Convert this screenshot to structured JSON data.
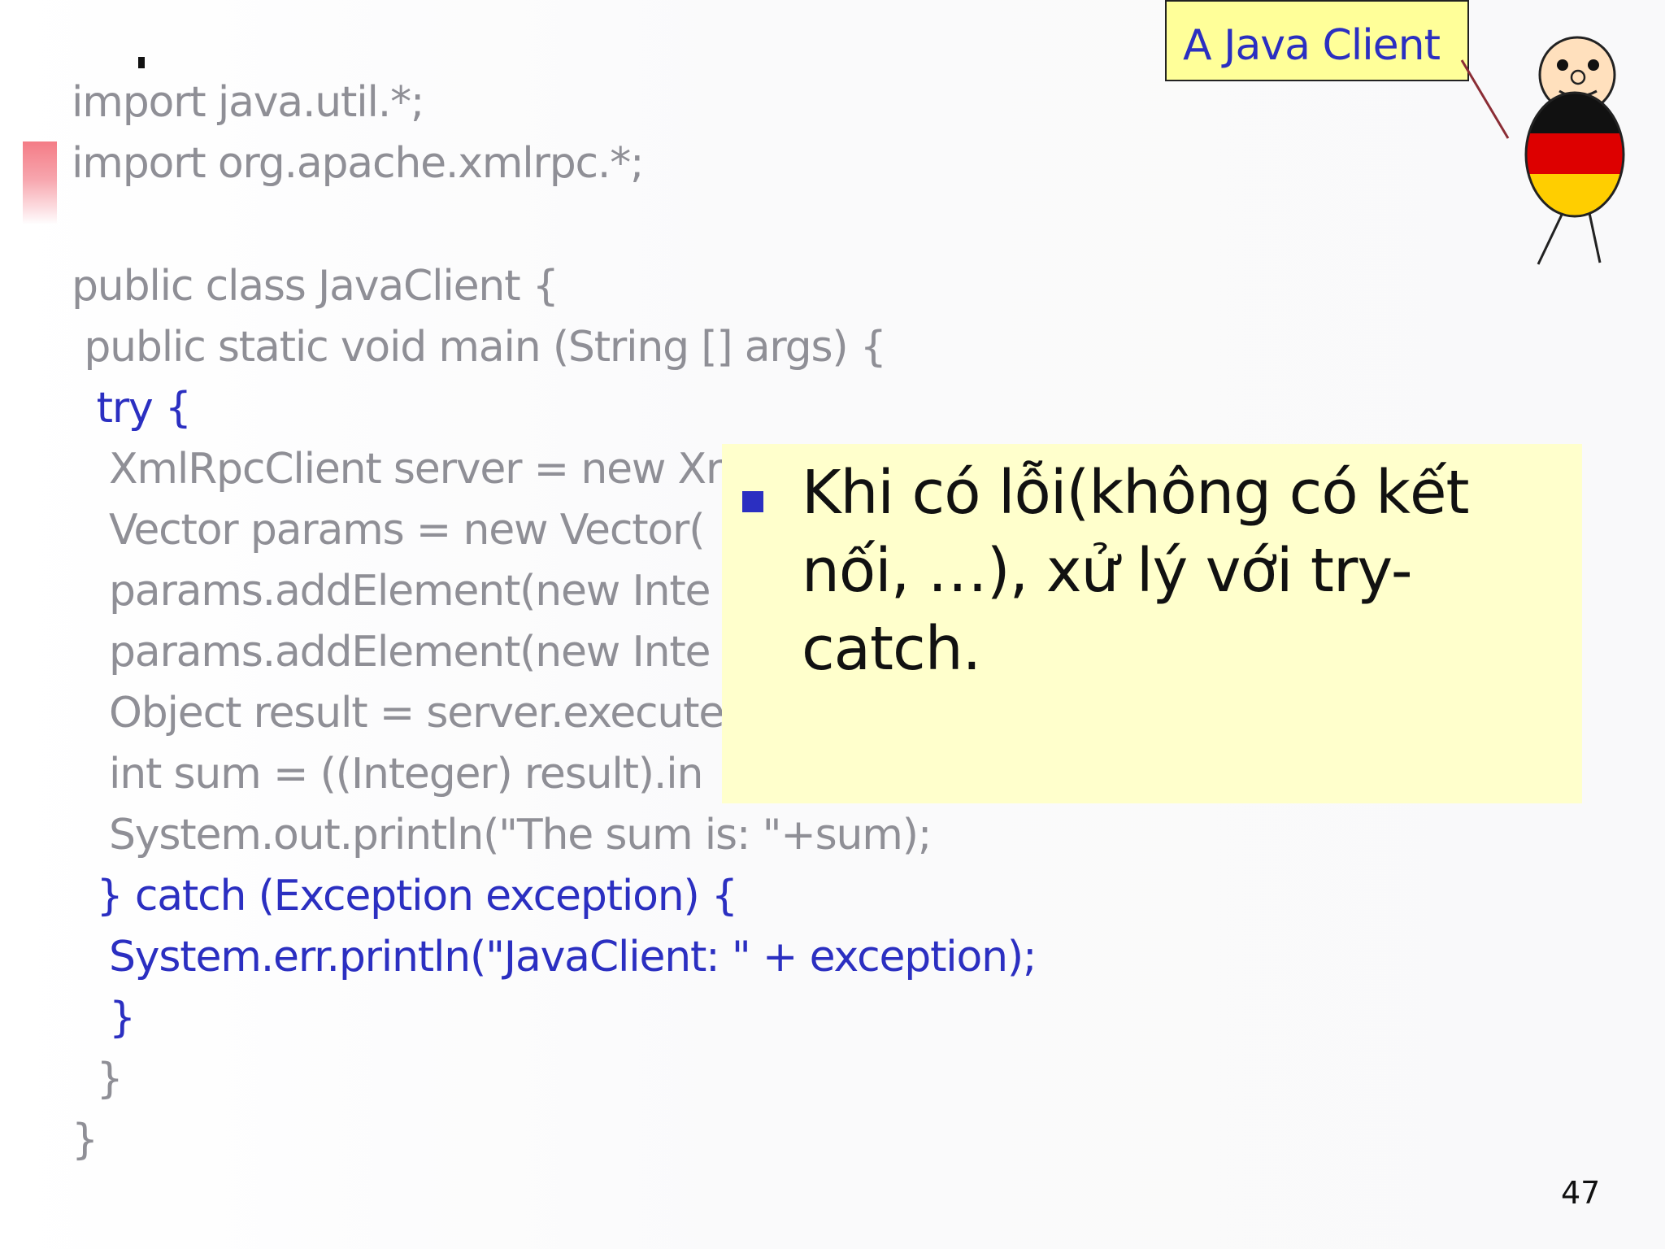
{
  "code": {
    "lines": [
      "import java.util.*;",
      "import org.apache.xmlrpc.*;",
      "public class JavaClient {",
      " public static void main (String [] args) {",
      "  try {",
      "   XmlRpcClient server = new Xr",
      "   Vector params = new Vector(",
      "   params.addElement(new Inte",
      "   params.addElement(new Inte",
      "   Object result = server.execute",
      "   int sum = ((Integer) result).in",
      "   System.out.println(\"The sum is: \"+sum);",
      "  } catch (Exception exception) {",
      "   System.err.println(\"JavaClient: \" + exception);",
      "   }",
      "  }",
      "}"
    ]
  },
  "callout": {
    "text": "Khi có lỗi(không có kết nối, …), xử lý với try-catch."
  },
  "label": {
    "text": "A Java Client"
  },
  "page": {
    "number": "47"
  },
  "colors": {
    "keyword_blue": "#2b2fc1",
    "code_gray": "#8f8f96",
    "callout_bg": "#ffffcc",
    "label_bg": "#ffff99",
    "accent_red": "#f47c86",
    "flag_black": "#111111",
    "flag_red": "#dd0000",
    "flag_gold": "#ffce00",
    "face": "#ffe0bd"
  },
  "icons": {
    "mascot": "german-flag-stick-figure"
  }
}
